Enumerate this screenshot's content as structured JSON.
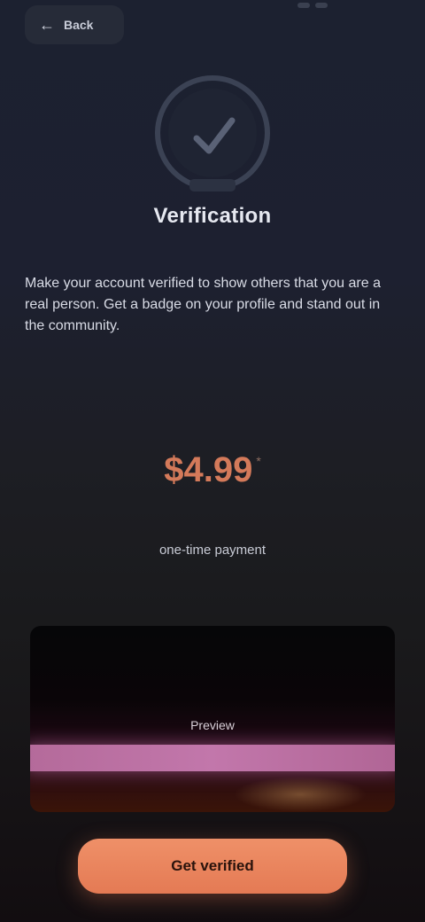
{
  "header": {
    "back_label": "Back",
    "icons": {
      "back": "arrow-left-icon"
    }
  },
  "hero": {
    "icon": "camera-check-icon",
    "title": "Verification"
  },
  "description": "Make your account verified to show others that you are a real person. Get a badge on your profile and stand out in the community.",
  "pricing": {
    "value": "$4.99",
    "note": "*",
    "caption": "one-time payment"
  },
  "media": {
    "label": "Preview"
  },
  "cta": {
    "label": "Get verified"
  },
  "colors": {
    "accent": "#e47a54",
    "band": "#c277ab",
    "background": "#1c2130"
  }
}
